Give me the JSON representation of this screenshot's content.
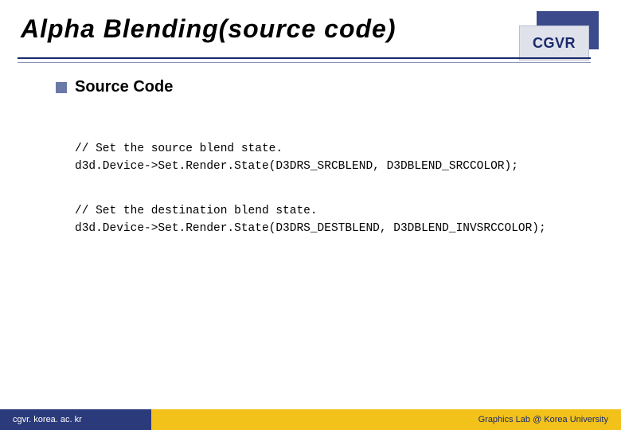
{
  "header": {
    "title": "Alpha Blending(source code)",
    "badge": "CGVR"
  },
  "bullet": {
    "label": "Source Code"
  },
  "code": {
    "block1_line1": "// Set the source blend state.",
    "block1_line2": "d3d.Device->Set.Render.State(D3DRS_SRCBLEND, D3DBLEND_SRCCOLOR);",
    "block2_line1": "// Set the destination blend state.",
    "block2_line2": "d3d.Device->Set.Render.State(D3DRS_DESTBLEND, D3DBLEND_INVSRCCOLOR);"
  },
  "footer": {
    "left": "cgvr. korea. ac. kr",
    "right": "Graphics Lab @ Korea University"
  }
}
